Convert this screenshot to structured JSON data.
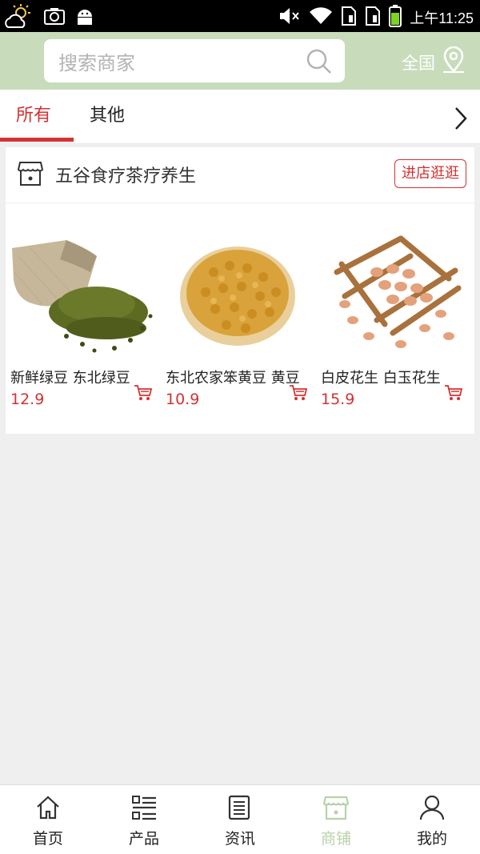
{
  "status_bar": {
    "time": "上午11:25"
  },
  "header": {
    "search_placeholder": "搜索商家",
    "region_label": "全国"
  },
  "tabs": [
    {
      "label": "所有",
      "active": true
    },
    {
      "label": "其他",
      "active": false
    }
  ],
  "shop": {
    "name": "五谷食疗茶疗养生",
    "visit_label": "进店逛逛",
    "products": [
      {
        "name": "新鲜绿豆 东北绿豆",
        "price": "12.9"
      },
      {
        "name": "东北农家笨黄豆 黄豆",
        "price": "10.9"
      },
      {
        "name": "白皮花生 白玉花生",
        "price": "15.9"
      }
    ]
  },
  "bottom_nav": [
    {
      "label": "首页",
      "icon": "home-icon"
    },
    {
      "label": "产品",
      "icon": "list-icon"
    },
    {
      "label": "资讯",
      "icon": "news-icon"
    },
    {
      "label": "商铺",
      "icon": "store-icon",
      "active": true
    },
    {
      "label": "我的",
      "icon": "user-icon"
    }
  ],
  "colors": {
    "accent": "#d63031",
    "header_bg": "#c8dcbc",
    "nav_active": "#b8d2a8"
  }
}
